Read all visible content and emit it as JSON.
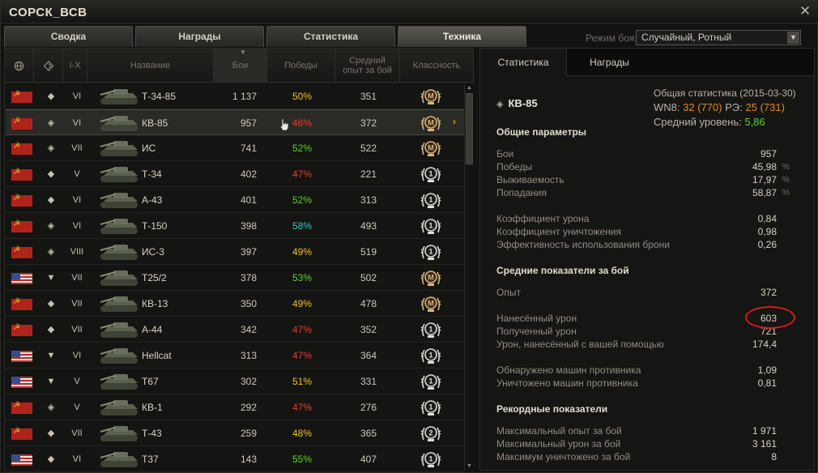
{
  "window": {
    "title": "СОРСК_ВСВ"
  },
  "tabs": [
    "Сводка",
    "Награды",
    "Статистика",
    "Техника"
  ],
  "active_tab": "Техника",
  "battle_mode": {
    "label": "Режим боя:",
    "value": "Случайный, Ротный"
  },
  "list_headers": {
    "nation": "",
    "type": "",
    "tier": "I-X",
    "name": "Название",
    "battles": "Бои",
    "wins": "Победы",
    "avg_xp_line1": "Средний",
    "avg_xp_line2": "опыт за бой",
    "mastery": "Классность"
  },
  "colors": {
    "winrate_orange": "#f0c12a",
    "winrate_red": "#ea3d2c",
    "winrate_green": "#5cd42c",
    "winrate_teal": "#37c7c3",
    "accent_orange": "#e3862a"
  },
  "tanks": [
    {
      "nation": "ussr",
      "type": "medium",
      "tier": "VI",
      "name": "Т-34-85",
      "battles": "1 137",
      "winrate": "50%",
      "wr_color": "#f0c12a",
      "avg_xp": "351",
      "mastery": "M"
    },
    {
      "nation": "ussr",
      "type": "heavy",
      "tier": "VI",
      "name": "КВ-85",
      "battles": "957",
      "winrate": "46%",
      "wr_color": "#ea3d2c",
      "avg_xp": "372",
      "mastery": "M"
    },
    {
      "nation": "ussr",
      "type": "heavy",
      "tier": "VII",
      "name": "ИС",
      "battles": "741",
      "winrate": "52%",
      "wr_color": "#5cd42c",
      "avg_xp": "522",
      "mastery": "M"
    },
    {
      "nation": "ussr",
      "type": "medium",
      "tier": "V",
      "name": "Т-34",
      "battles": "402",
      "winrate": "47%",
      "wr_color": "#ea3d2c",
      "avg_xp": "221",
      "mastery": "1"
    },
    {
      "nation": "ussr",
      "type": "medium",
      "tier": "VI",
      "name": "А-43",
      "battles": "401",
      "winrate": "52%",
      "wr_color": "#5cd42c",
      "avg_xp": "313",
      "mastery": "1"
    },
    {
      "nation": "ussr",
      "type": "heavy",
      "tier": "VI",
      "name": "Т-150",
      "battles": "398",
      "winrate": "58%",
      "wr_color": "#37c7c3",
      "avg_xp": "493",
      "mastery": "1"
    },
    {
      "nation": "ussr",
      "type": "heavy",
      "tier": "VIII",
      "name": "ИС-3",
      "battles": "397",
      "winrate": "49%",
      "wr_color": "#f0c12a",
      "avg_xp": "519",
      "mastery": "1"
    },
    {
      "nation": "usa",
      "type": "td",
      "tier": "VII",
      "name": "T25/2",
      "battles": "378",
      "winrate": "53%",
      "wr_color": "#5cd42c",
      "avg_xp": "502",
      "mastery": "M"
    },
    {
      "nation": "ussr",
      "type": "medium",
      "tier": "VII",
      "name": "КВ-13",
      "battles": "350",
      "winrate": "49%",
      "wr_color": "#f0c12a",
      "avg_xp": "478",
      "mastery": "M"
    },
    {
      "nation": "ussr",
      "type": "medium",
      "tier": "VII",
      "name": "А-44",
      "battles": "342",
      "winrate": "47%",
      "wr_color": "#ea3d2c",
      "avg_xp": "352",
      "mastery": "1"
    },
    {
      "nation": "usa",
      "type": "td",
      "tier": "VI",
      "name": "Hellcat",
      "battles": "313",
      "winrate": "47%",
      "wr_color": "#ea3d2c",
      "avg_xp": "364",
      "mastery": "1"
    },
    {
      "nation": "usa",
      "type": "td",
      "tier": "V",
      "name": "T67",
      "battles": "302",
      "winrate": "51%",
      "wr_color": "#f0c12a",
      "avg_xp": "331",
      "mastery": "1"
    },
    {
      "nation": "ussr",
      "type": "heavy",
      "tier": "V",
      "name": "КВ-1",
      "battles": "292",
      "winrate": "47%",
      "wr_color": "#ea3d2c",
      "avg_xp": "276",
      "mastery": "1"
    },
    {
      "nation": "ussr",
      "type": "medium",
      "tier": "VII",
      "name": "Т-43",
      "battles": "259",
      "winrate": "48%",
      "wr_color": "#f0c12a",
      "avg_xp": "365",
      "mastery": "2"
    },
    {
      "nation": "usa",
      "type": "medium",
      "tier": "VI",
      "name": "T37",
      "battles": "143",
      "winrate": "55%",
      "wr_color": "#5cd42c",
      "avg_xp": "407",
      "mastery": "1"
    }
  ],
  "detail": {
    "tabs": [
      "Статистика",
      "Награды"
    ],
    "tank_name": "КВ-85",
    "overall": {
      "title": "Общая статистика (2015-03-30)",
      "wn8_label": "WN8:",
      "wn8": "32",
      "wn8_paren": "(770)",
      "re_label": "РЭ:",
      "re": "25",
      "re_paren": "(731)",
      "avg_level_label": "Средний уровень:",
      "avg_level": "5,86"
    },
    "sections": [
      {
        "title": "Общие параметры",
        "items": [
          {
            "label": "Бои",
            "value": "957",
            "unit": ""
          },
          {
            "label": "Победы",
            "value": "45,98",
            "unit": "%"
          },
          {
            "label": "Выживаемость",
            "value": "17,97",
            "unit": "%"
          },
          {
            "label": "Попадания",
            "value": "58,87",
            "unit": "%"
          },
          {
            "label": "Коэффициент урона",
            "value": "0,84",
            "unit": ""
          },
          {
            "label": "Коэффициент уничтожения",
            "value": "0,98",
            "unit": ""
          },
          {
            "label": "Эффективность использования брони",
            "value": "0,26",
            "unit": ""
          }
        ]
      },
      {
        "title": "Средние показатели за бой",
        "items": [
          {
            "label": "Опыт",
            "value": "372",
            "unit": ""
          },
          {
            "label": "Нанесённый урон",
            "value": "603",
            "unit": ""
          },
          {
            "label": "Полученный урон",
            "value": "721",
            "unit": ""
          },
          {
            "label": "Урон, нанесённый с вашей помощью",
            "value": "174,4",
            "unit": ""
          },
          {
            "label": "Обнаружено машин противника",
            "value": "1,09",
            "unit": ""
          },
          {
            "label": "Уничтожено машин противника",
            "value": "0,81",
            "unit": ""
          }
        ]
      },
      {
        "title": "Рекордные показатели",
        "items": [
          {
            "label": "Максимальный опыт за бой",
            "value": "1 971",
            "unit": ""
          },
          {
            "label": "Максимальный урон за бой",
            "value": "3 161",
            "unit": ""
          },
          {
            "label": "Максимум уничтожено за бой",
            "value": "8",
            "unit": ""
          }
        ]
      }
    ]
  }
}
